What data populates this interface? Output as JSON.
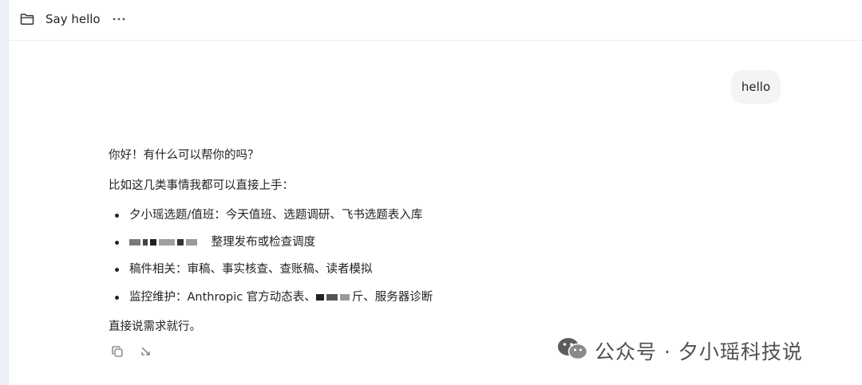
{
  "header": {
    "title": "Say hello",
    "more_label": "···"
  },
  "user_message": {
    "text": "hello"
  },
  "assistant_message": {
    "greeting": "你好！有什么可以帮你的吗？",
    "intro": "比如这几类事情我都可以直接上手：",
    "bullets": [
      "夕小瑶选题/值班：今天值班、选题调研、飞书选题表入库",
      "整理发布或检查调度",
      "稿件相关：审稿、事实核查、查账稿、读者模拟",
      "监控维护：Anthropic 官方动态表、",
      "斤、服务器诊断"
    ],
    "closing": "直接说需求就行。"
  },
  "watermark": {
    "text": "公众号 · 夕小瑶科技说"
  },
  "icons": {
    "folder": "folder-icon",
    "more": "more-horizontal-icon",
    "copy": "copy-icon",
    "retry": "retry-icon",
    "wechat": "wechat-logo-icon"
  }
}
